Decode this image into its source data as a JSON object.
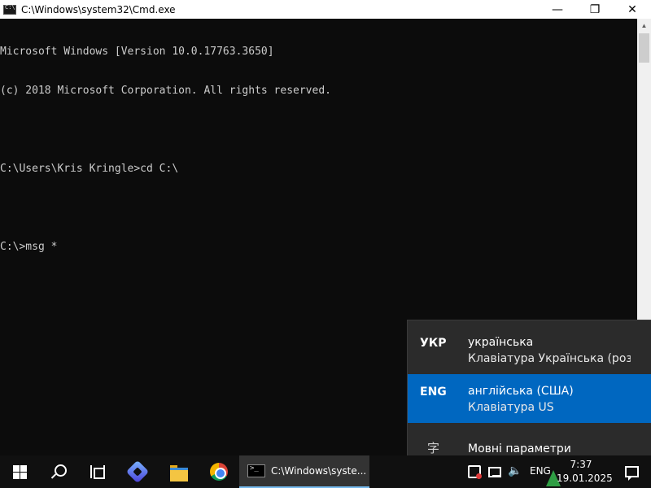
{
  "window": {
    "title": "C:\\Windows\\system32\\Cmd.exe",
    "minimize_glyph": "—",
    "maximize_glyph": "❐",
    "close_glyph": "✕"
  },
  "console": {
    "lines": [
      "Microsoft Windows [Version 10.0.17763.3650]",
      "(c) 2018 Microsoft Corporation. All rights reserved.",
      "",
      "C:\\Users\\Kris Kringle>cd C:\\",
      "",
      "C:\\>msg *"
    ]
  },
  "language_flyout": {
    "items": [
      {
        "code": "УКР",
        "name": "українська",
        "keyboard": "Клавіатура Українська (роз..."
      },
      {
        "code": "ENG",
        "name": "англійська (США)",
        "keyboard": "Клавіатура US"
      }
    ],
    "settings_label": "Мовні параметри",
    "selected_color": "#0067c0"
  },
  "taskbar": {
    "pinned": [
      "start",
      "search",
      "task-view",
      "power-automate",
      "file-explorer",
      "chrome"
    ],
    "open_window_label": "C:\\Windows\\syste...",
    "tray": {
      "language": "ENG",
      "time": "7:37",
      "date": "19.01.2025"
    },
    "volume_glyph": "🔈"
  }
}
